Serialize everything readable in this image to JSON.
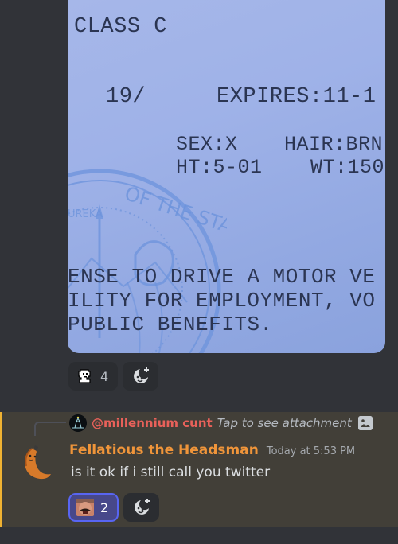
{
  "attachment": {
    "alt": "Photo of a state ID card",
    "lines": {
      "class": "CLASS C",
      "number": "19/",
      "expires": "EXPIRES:11-1",
      "sex": "SEX:X",
      "hair": "HAIR:BRN",
      "height": "HT:5-01",
      "weight": "WT:150",
      "para1": "ENSE TO DRIVE A MOTOR VE",
      "para2": "ILITY FOR EMPLOYMENT, VO",
      "para3": "PUBLIC BENEFITS."
    },
    "seal_text": {
      "arc": "OF THE STATE",
      "motto": "UREKA"
    }
  },
  "first_message_reactions": [
    {
      "emoji": "pixel-face-emoji",
      "count": "4"
    }
  ],
  "reply_message": {
    "replied_to": {
      "author": "@millennium cunt",
      "preview": "Tap to see attachment",
      "icon": "image-icon"
    },
    "author": "Fellatious the Headsman",
    "timestamp": "Today at 5:53 PM",
    "text": "is it ok if i still call you twitter",
    "reactions": [
      {
        "emoji": "laughing-man-emoji",
        "count": "2",
        "active": true
      }
    ]
  },
  "colors": {
    "background": "#313338",
    "highlight": "#423f38",
    "highlight_bar": "#f0b232",
    "reply_author": "#e8615a",
    "author": "#f0953a",
    "active_reaction_border": "#5865f2"
  }
}
